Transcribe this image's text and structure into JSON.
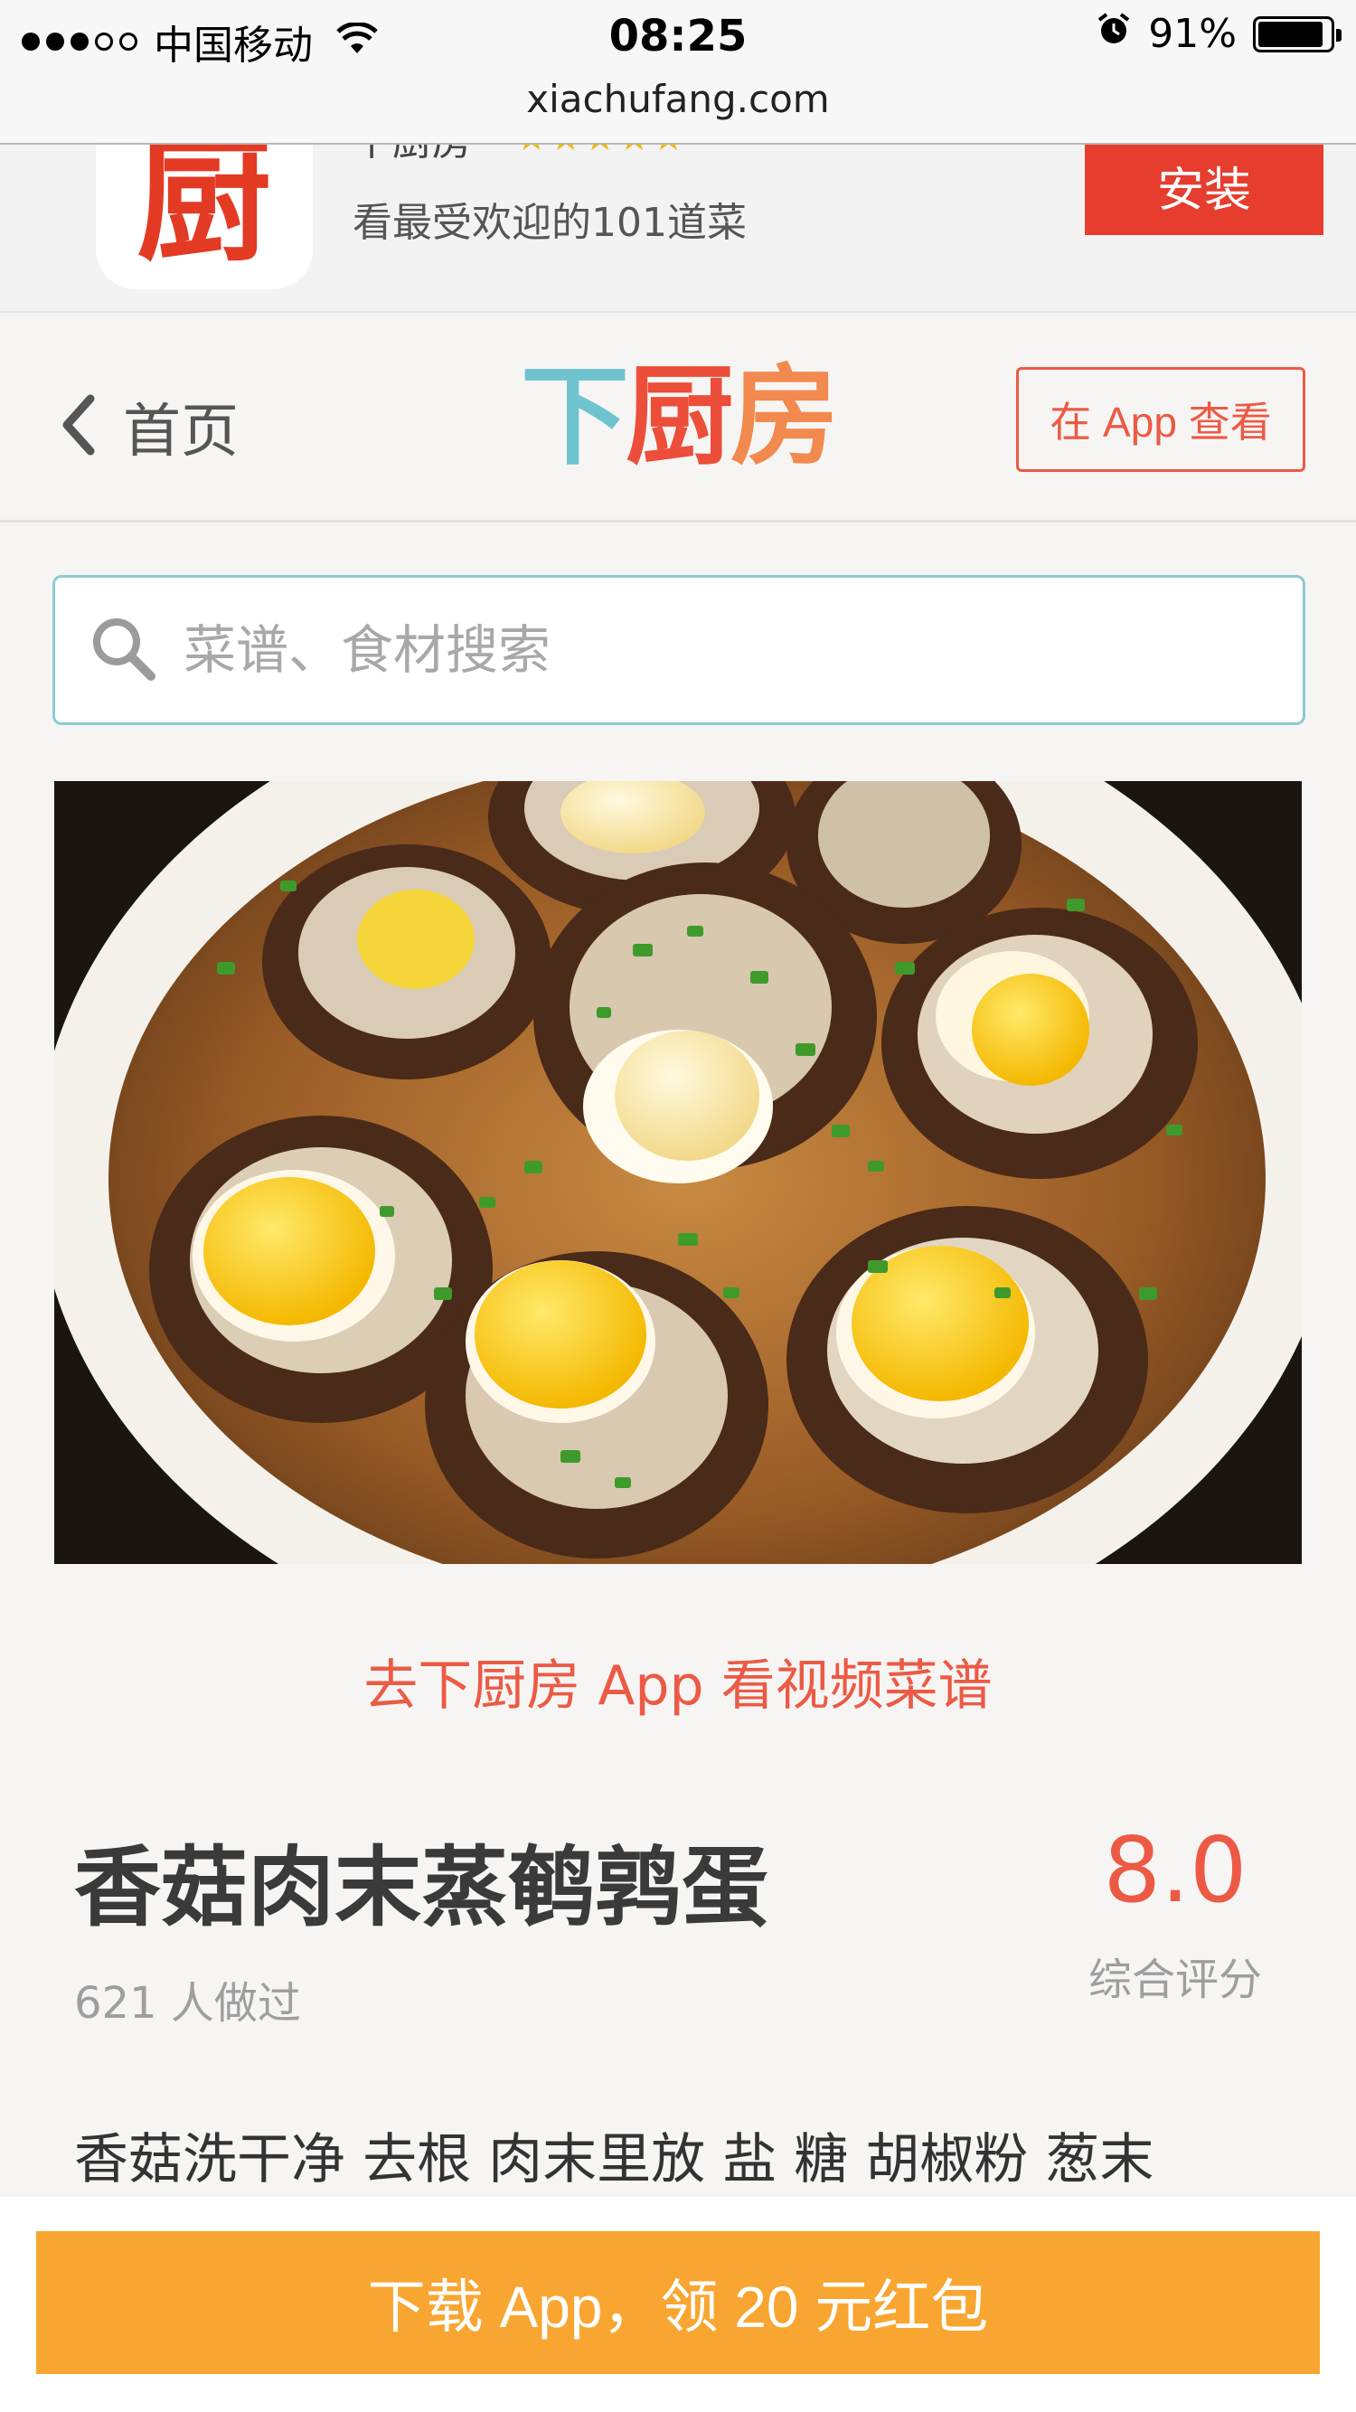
{
  "status_bar": {
    "carrier": "中国移动",
    "time": "08:25",
    "battery_percent": "91%",
    "battery_level": 0.91,
    "signal_bars_filled": 3,
    "signal_bars_total": 5
  },
  "url_bar": {
    "url": "xiachufang.com"
  },
  "app_banner": {
    "app_name": "下厨房",
    "icon_char": "厨",
    "rating_stars": "★★★★★",
    "description": "看最受欢迎的101道菜",
    "install_label": "安装"
  },
  "nav": {
    "back_label": "首页",
    "logo": {
      "part1": "下",
      "part2": "厨",
      "part3": "房"
    },
    "open_in_app_label": "在 App 查看"
  },
  "search": {
    "placeholder": "菜谱、食材搜索",
    "value": ""
  },
  "video_link": "去下厨房 App 看视频菜谱",
  "recipe": {
    "title": "香菇肉末蒸鹌鹑蛋",
    "made_count": "621 人做过",
    "score": "8.0",
    "score_label": "综合评分",
    "description_preview": "香菇洗干净 去根 肉末里放 盐 糖 胡椒粉 葱末"
  },
  "bottom": {
    "download_label": "下载 App，领 20 元红包"
  },
  "colors": {
    "accent_red": "#ec5a45",
    "install_red": "#e63d2e",
    "logo_teal": "#6fc3cf",
    "logo_orange": "#f2894e",
    "download_orange": "#f8a631",
    "search_border": "#8ccad2"
  }
}
